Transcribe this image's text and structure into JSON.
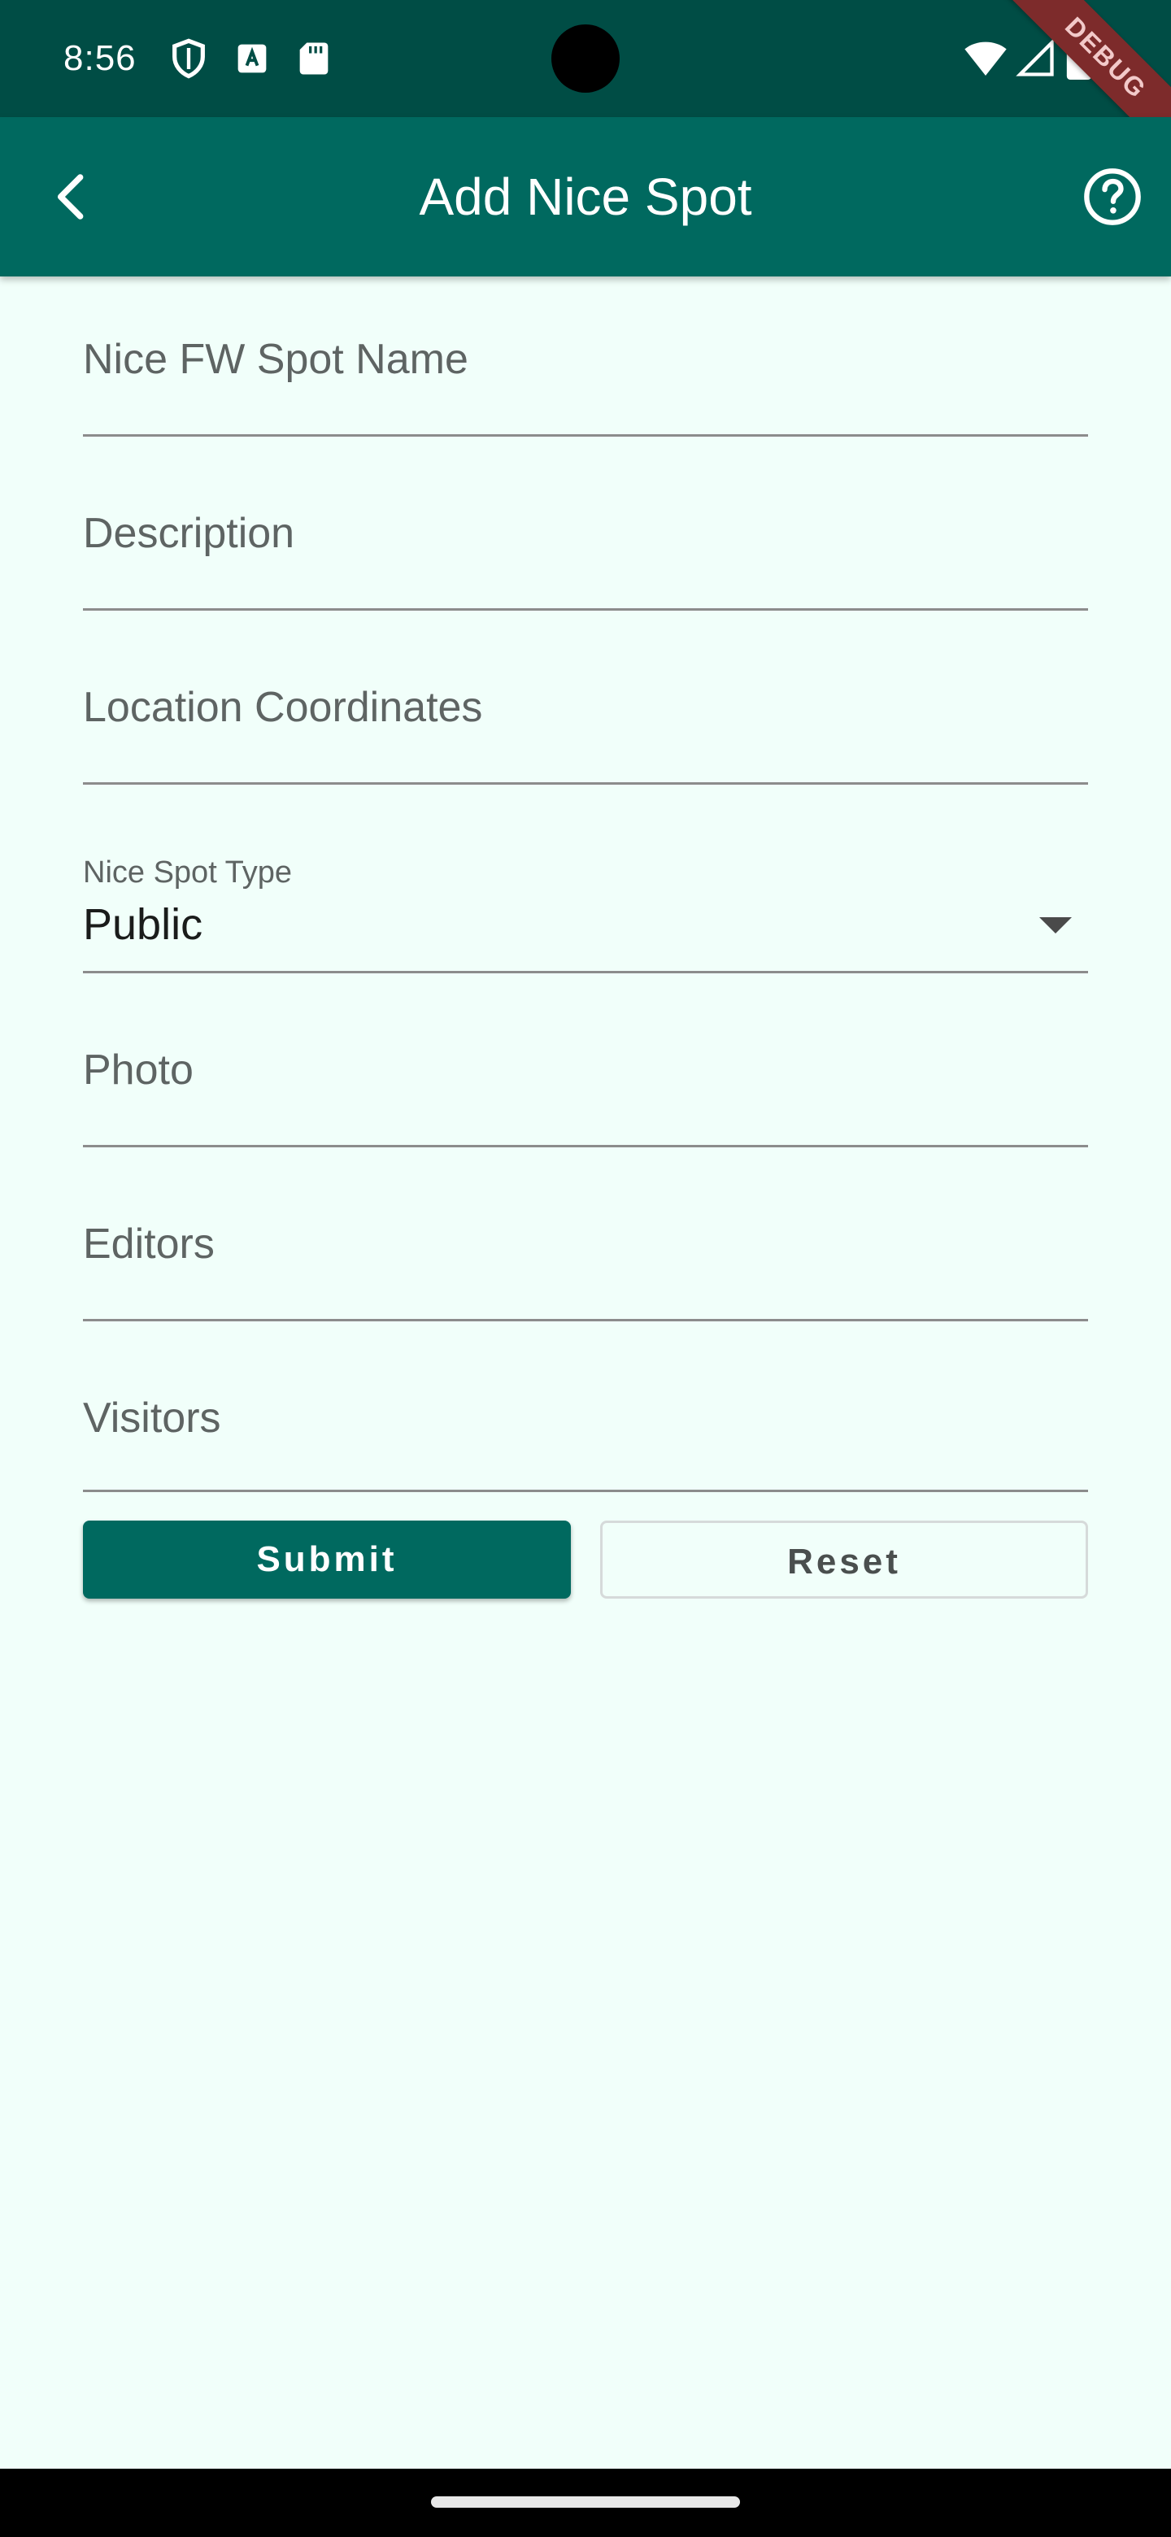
{
  "status_bar": {
    "time": "8:56",
    "icons": [
      "shield-icon",
      "font-a-icon",
      "sd-card-icon",
      "wifi-icon",
      "signal-icon",
      "battery-icon"
    ]
  },
  "debug_ribbon": "DEBUG",
  "app_bar": {
    "title": "Add Nice Spot",
    "back_icon": "chevron-left-icon",
    "help_icon": "help-circle-icon"
  },
  "form": {
    "name_hint": "Nice FW Spot Name",
    "description_hint": "Description",
    "coordinates_hint": "Location Coordinates",
    "spot_type": {
      "label": "Nice Spot Type",
      "value": "Public"
    },
    "photo_hint": "Photo",
    "editors_hint": "Editors",
    "visitors_hint": "Visitors"
  },
  "buttons": {
    "submit": "Submit",
    "reset": "Reset"
  },
  "colors": {
    "primary": "#00695F",
    "status_bar": "#004D45",
    "background": "#F1FFFA"
  }
}
